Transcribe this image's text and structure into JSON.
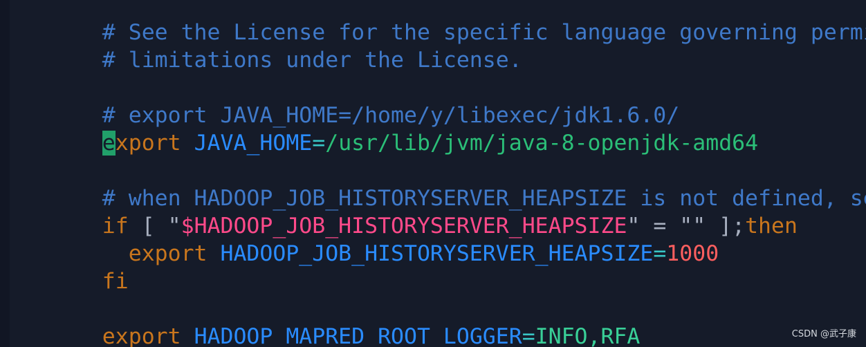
{
  "editor": {
    "lines": [
      {
        "segments": [
          {
            "text": "# See the License for the specific language governing permissions and"
          }
        ]
      },
      {
        "segments": [
          {
            "text": "# limitations under the License."
          }
        ]
      },
      {
        "segments": [
          {
            "text": ""
          }
        ]
      },
      {
        "segments": [
          {
            "text": "# export JAVA_HOME=/home/y/libexec/jdk1.6.0/"
          }
        ]
      },
      {
        "segments": [
          {
            "text": "e"
          },
          {
            "text": "xport"
          },
          {
            "text": " "
          },
          {
            "text": "JAVA_HOME"
          },
          {
            "text": "="
          },
          {
            "text": "/usr/lib/jvm/java-8-openjdk-amd64"
          }
        ]
      },
      {
        "segments": [
          {
            "text": ""
          }
        ]
      },
      {
        "segments": [
          {
            "text": "# when HADOOP_JOB_HISTORYSERVER_HEAPSIZE is not defined, set it."
          }
        ]
      },
      {
        "segments": [
          {
            "text": "if"
          },
          {
            "text": " [ "
          },
          {
            "text": "\""
          },
          {
            "text": "$HADOOP_JOB_HISTORYSERVER_HEAPSIZE"
          },
          {
            "text": "\" = \"\" ];"
          },
          {
            "text": "then"
          }
        ]
      },
      {
        "segments": [
          {
            "text": "  export"
          },
          {
            "text": " "
          },
          {
            "text": "HADOOP_JOB_HISTORYSERVER_HEAPSIZE"
          },
          {
            "text": "="
          },
          {
            "text": "1000"
          }
        ]
      },
      {
        "segments": [
          {
            "text": "fi"
          }
        ]
      },
      {
        "segments": [
          {
            "text": ""
          }
        ]
      },
      {
        "segments": [
          {
            "text": "export"
          },
          {
            "text": " "
          },
          {
            "text": "HADOOP_MAPRED_ROOT_LOGGER"
          },
          {
            "text": "="
          },
          {
            "text": "INFO,RFA"
          }
        ]
      }
    ]
  },
  "watermark": {
    "text": "CSDN @武子康"
  },
  "colors": {
    "background": "#151b29",
    "comment": "#3f79c9",
    "keyword": "#c9761d",
    "variable": "#2a8cff",
    "operator": "#38c6c6",
    "string_variable": "#ff4a8a",
    "number": "#ff5f5f",
    "cursor": "#21a06a"
  }
}
